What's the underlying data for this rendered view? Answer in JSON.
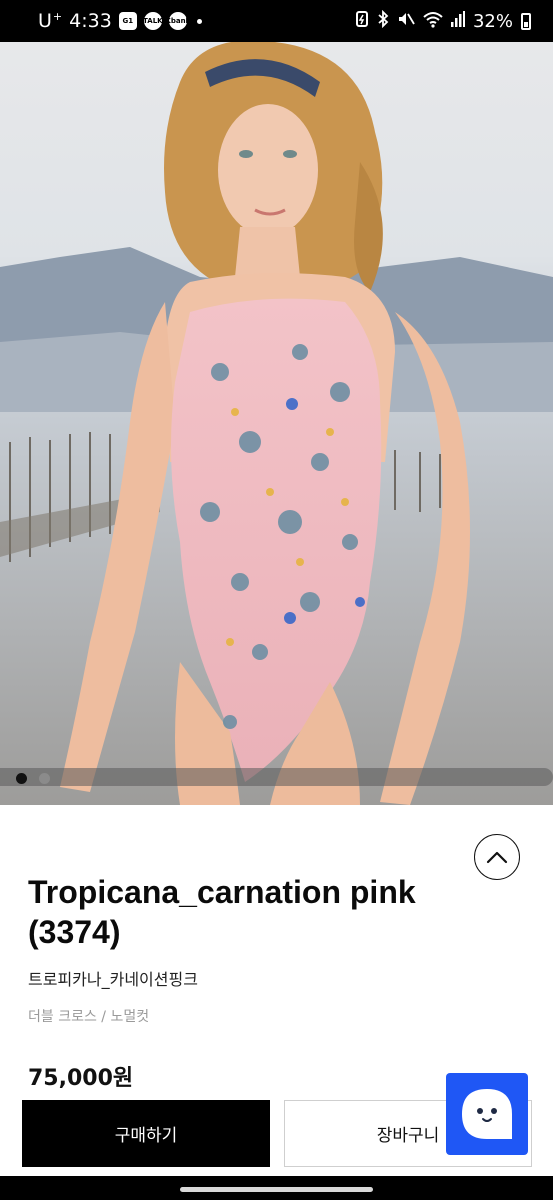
{
  "status_bar": {
    "carrier": "U",
    "carrier_sup": "+",
    "time": "4:33",
    "apps": [
      "G1",
      "TALK",
      "Kbank"
    ],
    "battery": "32%"
  },
  "carousel": {
    "image_count": 2,
    "active_index": 0
  },
  "product": {
    "title": "Tropicana_carnation pink (3374)",
    "subtitle_ko": "트로피카나_카네이션핑크",
    "category": "더블 크로스 / 노멀컷",
    "price": "75,000원"
  },
  "actions": {
    "buy_label": "구매하기",
    "cart_label": "장바구니"
  },
  "colors": {
    "accent": "#1f57f5",
    "buy_button": "#000000"
  }
}
